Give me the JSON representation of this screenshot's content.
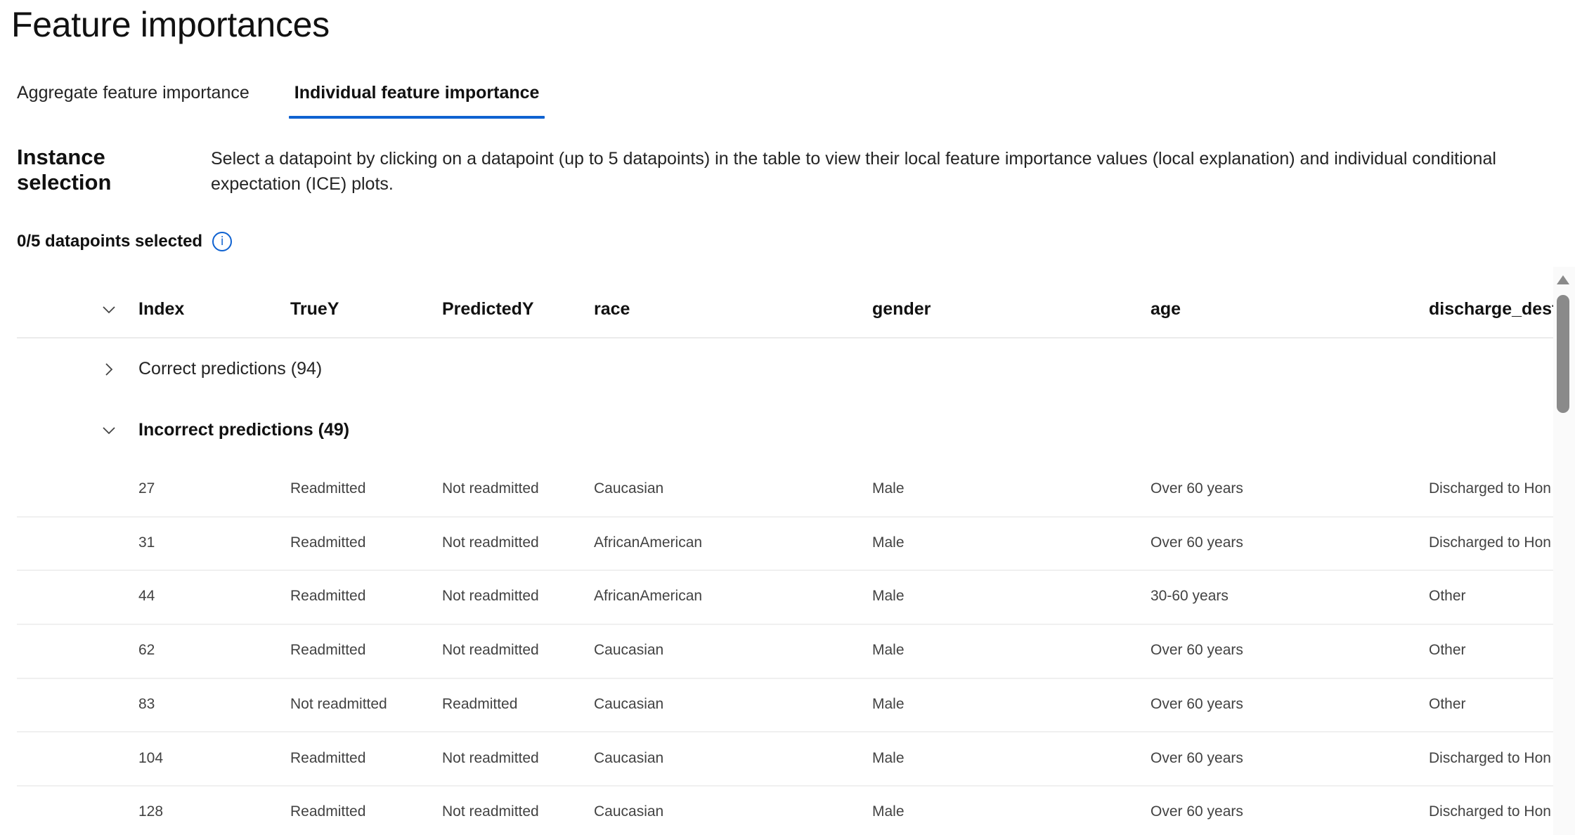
{
  "page": {
    "title": "Feature importances"
  },
  "tabs": [
    {
      "label": "Aggregate feature importance",
      "active": false
    },
    {
      "label": "Individual feature importance",
      "active": true
    }
  ],
  "instance_selection": {
    "title": "Instance selection",
    "description": "Select a datapoint by clicking on a datapoint (up to 5 datapoints) in the table to view their local feature importance values (local explanation) and individual conditional expectation (ICE) plots.",
    "selected_count": "0/5 datapoints selected",
    "info_icon": "info-icon"
  },
  "table": {
    "columns": [
      "Index",
      "TrueY",
      "PredictedY",
      "race",
      "gender",
      "age",
      "discharge_desti"
    ],
    "groups": [
      {
        "label": "Correct predictions (94)",
        "expanded": false
      },
      {
        "label": "Incorrect predictions (49)",
        "expanded": true
      }
    ],
    "rows": [
      [
        "27",
        "Readmitted",
        "Not readmitted",
        "Caucasian",
        "Male",
        "Over 60 years",
        "Discharged to Hon"
      ],
      [
        "31",
        "Readmitted",
        "Not readmitted",
        "AfricanAmerican",
        "Male",
        "Over 60 years",
        "Discharged to Hon"
      ],
      [
        "44",
        "Readmitted",
        "Not readmitted",
        "AfricanAmerican",
        "Male",
        "30-60 years",
        "Other"
      ],
      [
        "62",
        "Readmitted",
        "Not readmitted",
        "Caucasian",
        "Male",
        "Over 60 years",
        "Other"
      ],
      [
        "83",
        "Not readmitted",
        "Readmitted",
        "Caucasian",
        "Male",
        "Over 60 years",
        "Other"
      ],
      [
        "104",
        "Readmitted",
        "Not readmitted",
        "Caucasian",
        "Male",
        "Over 60 years",
        "Discharged to Hon"
      ],
      [
        "128",
        "Readmitted",
        "Not readmitted",
        "Caucasian",
        "Male",
        "Over 60 years",
        "Discharged to Hon"
      ]
    ]
  },
  "colors": {
    "accent": "#0f62d1",
    "divider": "#ebebeb",
    "scrollbar_thumb": "#8a8a8a"
  }
}
